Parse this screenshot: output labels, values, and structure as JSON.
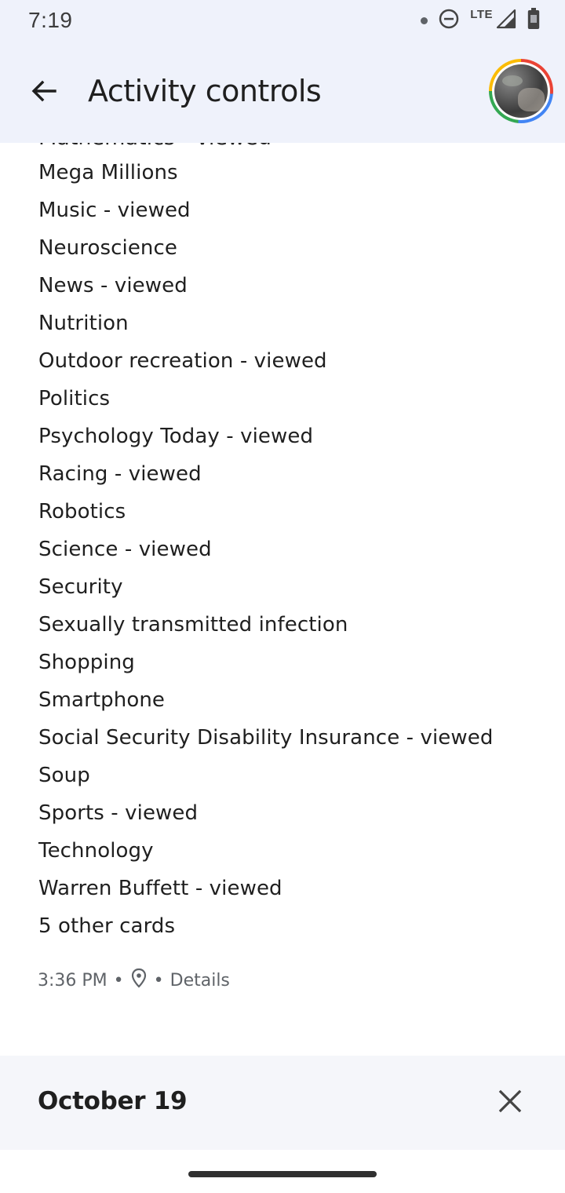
{
  "status_bar": {
    "time": "7:19",
    "network_label": "LTE",
    "icons": [
      "notification-dot-icon",
      "do-not-disturb-icon",
      "signal-icon",
      "battery-icon"
    ]
  },
  "app_bar": {
    "title": "Activity controls",
    "back_icon": "arrow-back-icon",
    "avatar": "account-avatar"
  },
  "activity": {
    "cut_off_item": "Mathematics - viewed",
    "topics": [
      "Mega Millions",
      "Music - viewed",
      "Neuroscience",
      "News - viewed",
      "Nutrition",
      "Outdoor recreation - viewed",
      "Politics",
      "Psychology Today - viewed",
      "Racing - viewed",
      "Robotics",
      "Science - viewed",
      "Security",
      "Sexually transmitted infection",
      "Shopping",
      "Smartphone",
      "Social Security Disability Insurance - viewed",
      "Soup",
      "Sports - viewed",
      "Technology",
      "Warren Buffett - viewed",
      "5 other cards"
    ],
    "meta": {
      "time": "3:36 PM",
      "separator": "•",
      "location_icon": "location-pin-icon",
      "details_label": "Details"
    }
  },
  "next_group": {
    "date": "October 19",
    "close_icon": "close-icon"
  },
  "colors": {
    "header_bg": "#eff2fb",
    "card_bg": "#f5f6fa",
    "text_primary": "#1f1f1f",
    "text_secondary": "#5f6368"
  }
}
